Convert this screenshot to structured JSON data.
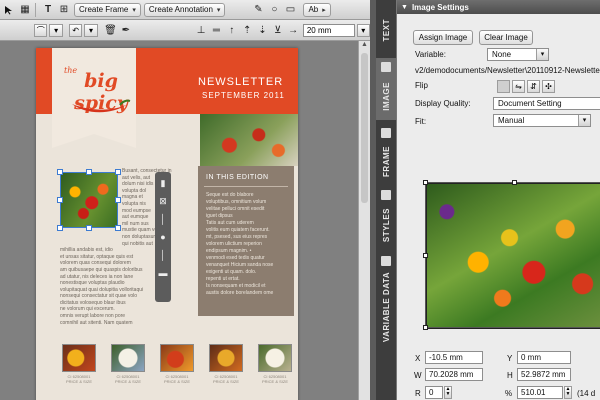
{
  "toolbar": {
    "create_frame_label": "Create Frame",
    "create_annotation_label": "Create Annotation",
    "ab_label": "Ab",
    "dimension_value": "20 mm"
  },
  "newsletter": {
    "logo_the": "the",
    "logo_text": "big spicy",
    "title": "NEWSLETTER",
    "date": "SEPTEMBER 2011",
    "edition_heading": "IN THIS EDITION",
    "edition_lines": [
      "Seque est do blabore",
      "voluptibus, omnitium volum",
      "velitae pelluci omnit esedit",
      "iguet dipsus",
      "Tatis aut cum uderem",
      "volitis eum quiatem facerunt.",
      "mt, psesed, sus eius repres",
      "volorem ulictium reperion",
      "endipsum magnim. •",
      "venmodi esed tedis quatur",
      "venanquet Hicium sanda nose",
      "exigenti ut quam. dolo.",
      "repenti ut ertat.",
      "Is nonsequam et modicil et",
      "austis dolore borelandem ome"
    ],
    "body_lines": [
      "Busant, consectetur in",
      "aut velis, aut",
      "dolum nisi idis",
      "volupta dol",
      "magna et",
      "volupta nis",
      "mod eumpse",
      "aut eumque",
      "mil num sus",
      "mustie quam velles",
      "non doluptasum nis",
      "qui nobitis aut",
      "mihillia andabis est, idio",
      "et unsas sitatur, optaque quis est",
      "volorem quas consequi dolorem",
      "am quibusaepe qui quaspis doloribus",
      "ad utatur, nis deleces ia non lane",
      "nonestisque voluptas plaudio",
      "volupitaquat quai dolupitia volloritaqui",
      "nonsequi consectatur sit quae volo",
      "dicitatus volosequo blaur ibus",
      "ne volorum qui excerum.",
      "omnis verupt labore non pore",
      "comnihil aut sitenti. Nam quatem"
    ],
    "thumb_captions": [
      "CI 62508001\nPRICE & SIZE",
      "CI 62508001\nPRICE & SIZE",
      "CI 62508001\nPRICE & SIZE",
      "CI 62508001\nPRICE & SIZE",
      "CI 62508001\nPRICE & SIZE"
    ]
  },
  "side_tabs": [
    "TEXT",
    "IMAGE",
    "FRAME",
    "STYLES",
    "VARIABLE DATA"
  ],
  "panel": {
    "title": "Image Settings",
    "assign_image_label": "Assign Image",
    "clear_image_label": "Clear Image",
    "variable_label": "Variable:",
    "variable_value": "None",
    "path": "v2/demodocuments/Newsletter\\20110912-Newsletter",
    "flip_label": "Flip",
    "display_quality_label": "Display Quality:",
    "display_quality_value": "Document Setting",
    "fit_label": "Fit:",
    "fit_value": "Manual",
    "x_label": "X",
    "x_value": "-10.5 mm",
    "y_label": "Y",
    "y_value": "0 mm",
    "w_label": "W",
    "w_value": "70.2028 mm",
    "h_label": "H",
    "h_value": "52.9872 mm",
    "r_label": "R",
    "r_value": "0",
    "percent_label": "%",
    "percent_value": "510.01",
    "dpi_value": "(14 d"
  },
  "colors": {
    "banner": "#e14a25",
    "page": "#ebe4da",
    "edition_box": "#8c7d6f",
    "panel_bg": "#ececec",
    "selection": "#3c7bd1"
  }
}
